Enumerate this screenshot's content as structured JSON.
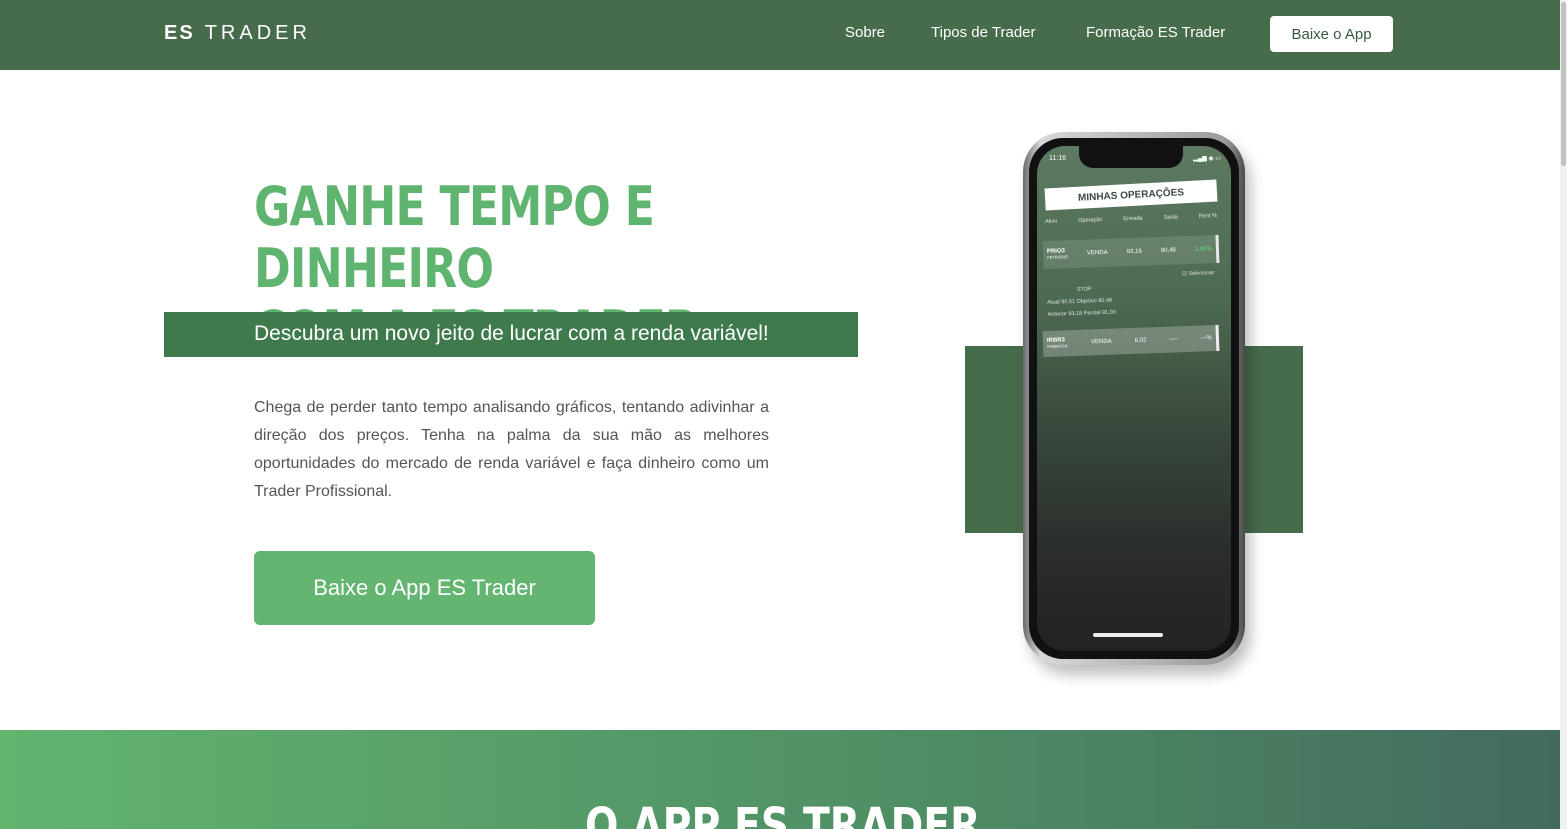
{
  "brand": {
    "bold": "ES",
    "light": "TRADER"
  },
  "nav": {
    "links": [
      "Sobre",
      "Tipos de Trader",
      "Formação ES Trader"
    ],
    "cta": "Baixe o App"
  },
  "hero": {
    "title_line1": "GANHE TEMPO E DINHEIRO",
    "title_line2": "COM A ES TRADER",
    "subtitle": "Descubra um novo jeito de lucrar com a renda variável!",
    "description": "Chega de perder tanto tempo analisando gráficos, tentando adivinhar a direção dos preços. Tenha na palma da sua mão as melhores oportunidades do mercado de renda variável e faça dinheiro como um Trader Profissional.",
    "cta": "Baixe o App ES Trader"
  },
  "phone": {
    "time": "11:16",
    "status": "▂▄▆ ◉ ▭",
    "title": "MINHAS OPERAÇÕES",
    "headers": [
      "Ativo",
      "Operação",
      "Entrada",
      "Saída",
      "Rent %"
    ],
    "row1": {
      "asset": "PRIO3",
      "sub": "PETRORIO",
      "op": "VENDA",
      "entry": "93,16",
      "exit": "90,48",
      "pct": "2,96%"
    },
    "select_label": "☑ Selecionar",
    "stop_label": "STOP",
    "detail1": "Atual 90,51   Objetivo 90,48",
    "detail2": "Anterior 93,18   Parcial 91,00",
    "row2": {
      "asset": "IRBR3",
      "sub": "IRBBRASIL",
      "op": "VENDA",
      "entry": "6,02",
      "exit": "----",
      "pct": "---%"
    }
  },
  "section2": {
    "title": "O APP ES TRADER"
  },
  "colors": {
    "nav": "#476c4c",
    "accent": "#5fb46f",
    "subtitle_bg": "#3f7a4c",
    "cta": "#63b571"
  }
}
